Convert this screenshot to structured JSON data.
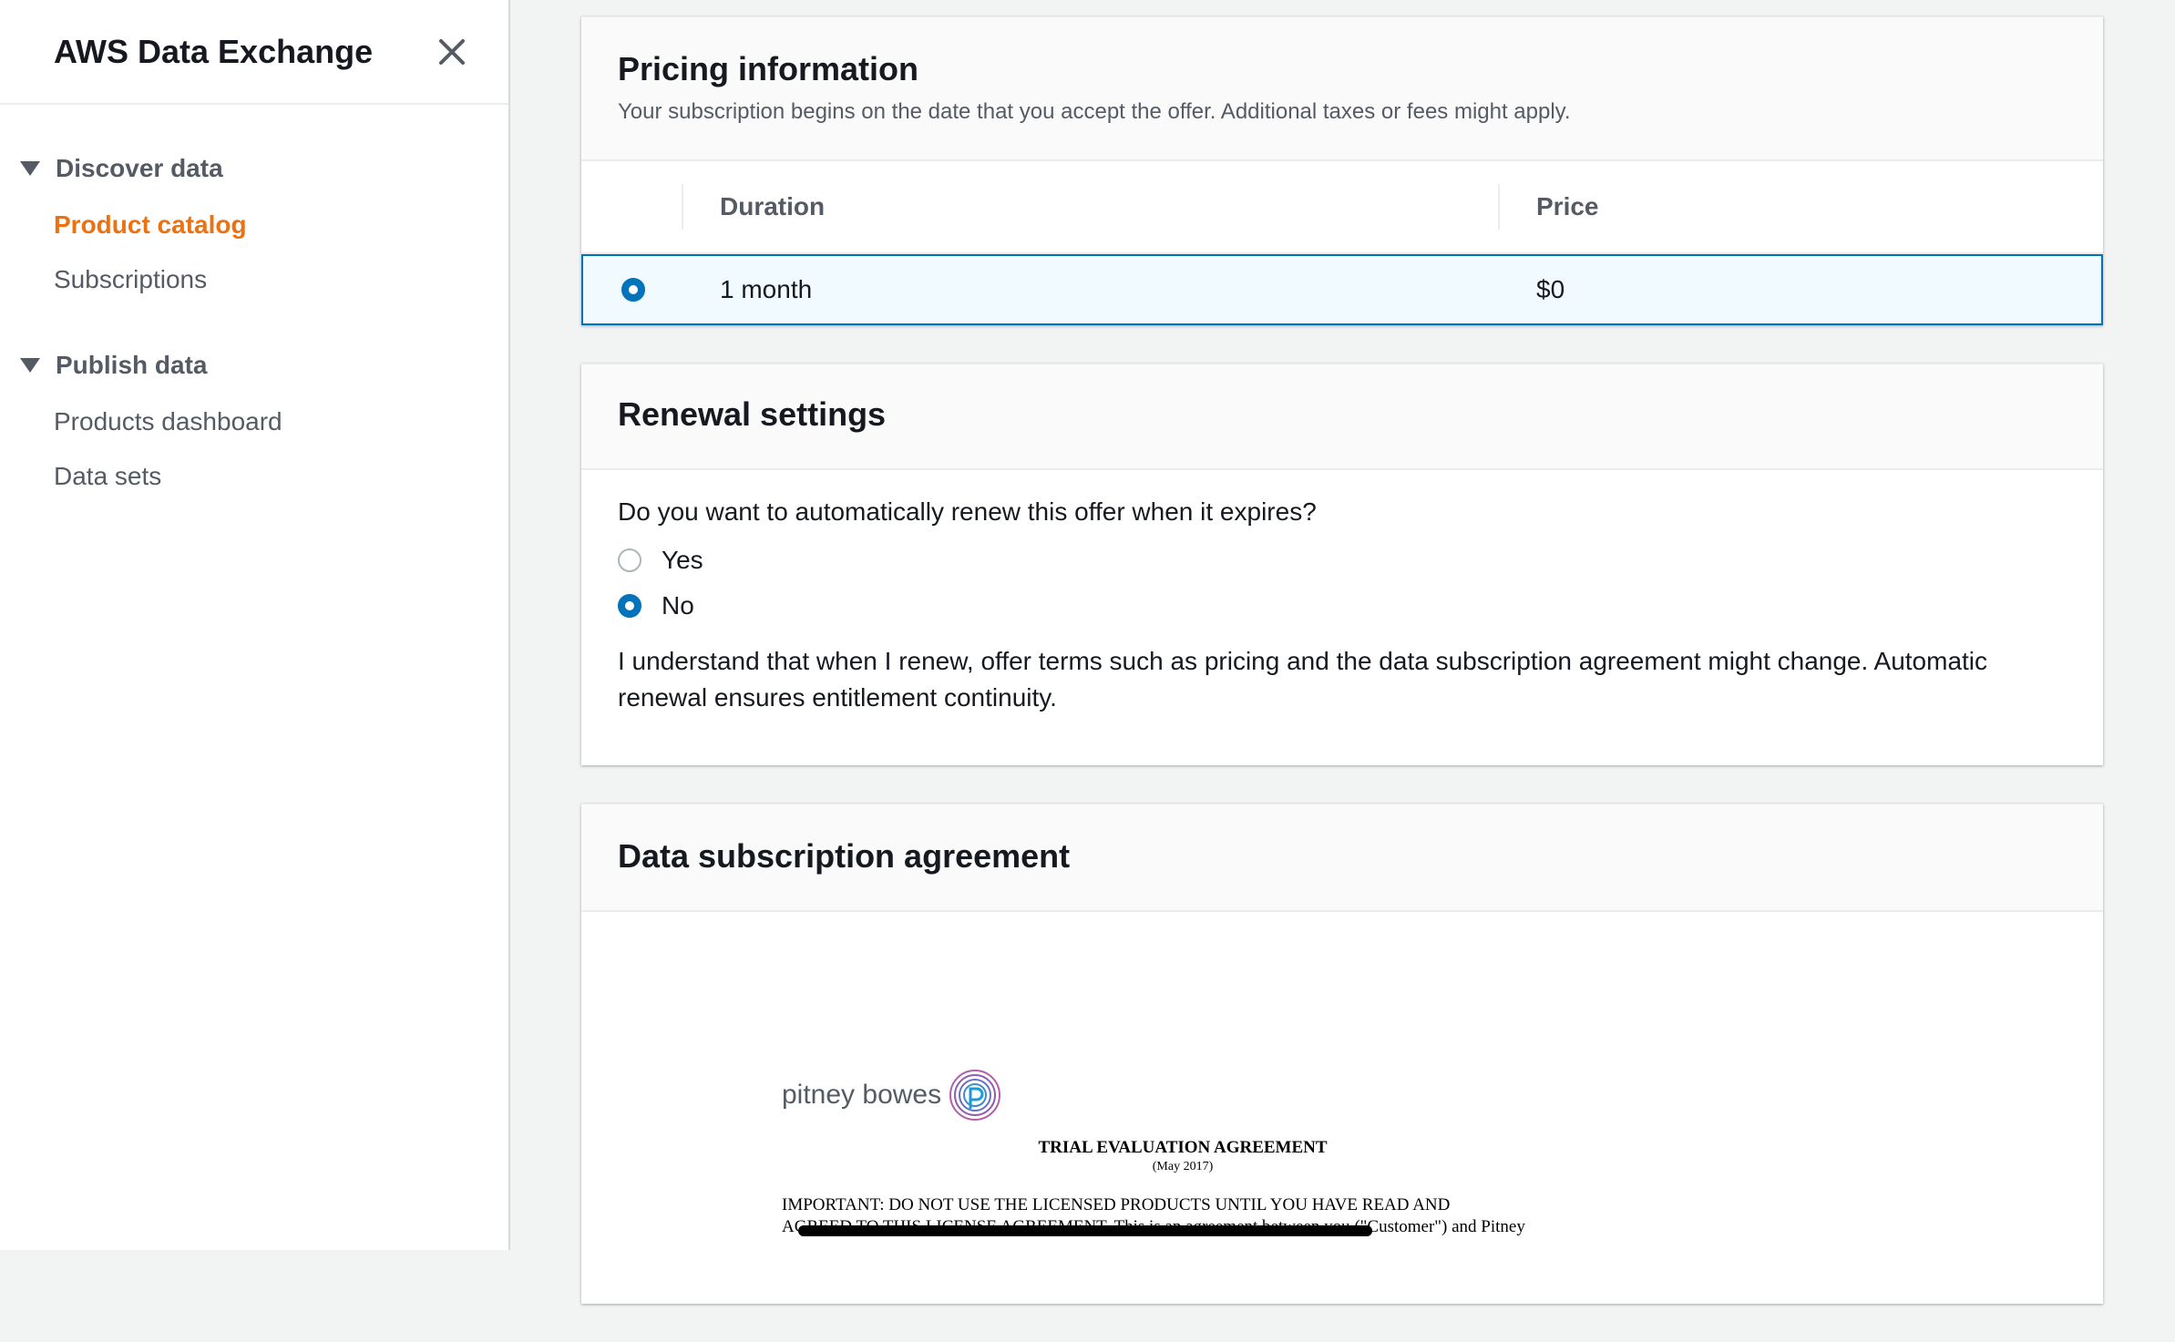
{
  "sidebar": {
    "title": "AWS Data Exchange",
    "close_icon": "close-icon",
    "sections": [
      {
        "label": "Discover data",
        "items": [
          {
            "label": "Product catalog",
            "active": true
          },
          {
            "label": "Subscriptions",
            "active": false
          }
        ]
      },
      {
        "label": "Publish data",
        "items": [
          {
            "label": "Products dashboard",
            "active": false
          },
          {
            "label": "Data sets",
            "active": false
          }
        ]
      }
    ]
  },
  "pricing": {
    "title": "Pricing information",
    "description": "Your subscription begins on the date that you accept the offer. Additional taxes or fees might apply.",
    "columns": {
      "duration": "Duration",
      "price": "Price"
    },
    "rows": [
      {
        "duration": "1 month",
        "price": "$0",
        "selected": true
      }
    ]
  },
  "renewal": {
    "title": "Renewal settings",
    "question": "Do you want to automatically renew this offer when it expires?",
    "options": [
      {
        "label": "Yes",
        "selected": false
      },
      {
        "label": "No",
        "selected": true
      }
    ],
    "notice": "I understand that when I renew, offer terms such as pricing and the data subscription agreement might change. Automatic renewal ensures entitlement continuity."
  },
  "agreement": {
    "title": "Data subscription agreement",
    "logo_text": "pitney bowes",
    "doc_title": "TRIAL EVALUATION AGREEMENT",
    "doc_date": "(May 2017)",
    "doc_line1": "IMPORTANT: DO NOT USE THE LICENSED PRODUCTS UNTIL YOU HAVE READ AND",
    "doc_line2": "AGREED TO THIS LICENSE AGREEMENT. This is an agreement between you (\"Customer\") and Pitney"
  },
  "colors": {
    "accent": "#0073bb",
    "active_nav": "#ec7211",
    "selected_row_bg": "#f1faff"
  }
}
